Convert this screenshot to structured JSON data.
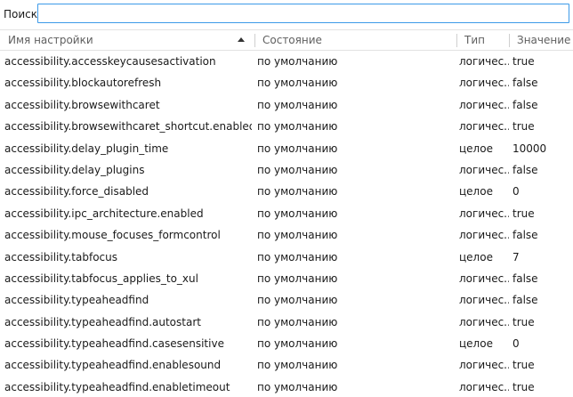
{
  "search": {
    "label": "Поиск:",
    "value": "",
    "placeholder": ""
  },
  "columns": {
    "name": "Имя настройки",
    "state": "Состояние",
    "type": "Тип",
    "value": "Значение"
  },
  "sort": {
    "column": "name",
    "direction": "ascending"
  },
  "rows": [
    {
      "name": "accessibility.accesskeycausesactivation",
      "state": "по умолчанию",
      "type": "логичес...",
      "value": "true"
    },
    {
      "name": "accessibility.blockautorefresh",
      "state": "по умолчанию",
      "type": "логичес...",
      "value": "false"
    },
    {
      "name": "accessibility.browsewithcaret",
      "state": "по умолчанию",
      "type": "логичес...",
      "value": "false"
    },
    {
      "name": "accessibility.browsewithcaret_shortcut.enabled",
      "state": "по умолчанию",
      "type": "логичес...",
      "value": "true"
    },
    {
      "name": "accessibility.delay_plugin_time",
      "state": "по умолчанию",
      "type": "целое",
      "value": "10000"
    },
    {
      "name": "accessibility.delay_plugins",
      "state": "по умолчанию",
      "type": "логичес...",
      "value": "false"
    },
    {
      "name": "accessibility.force_disabled",
      "state": "по умолчанию",
      "type": "целое",
      "value": "0"
    },
    {
      "name": "accessibility.ipc_architecture.enabled",
      "state": "по умолчанию",
      "type": "логичес...",
      "value": "true"
    },
    {
      "name": "accessibility.mouse_focuses_formcontrol",
      "state": "по умолчанию",
      "type": "логичес...",
      "value": "false"
    },
    {
      "name": "accessibility.tabfocus",
      "state": "по умолчанию",
      "type": "целое",
      "value": "7"
    },
    {
      "name": "accessibility.tabfocus_applies_to_xul",
      "state": "по умолчанию",
      "type": "логичес...",
      "value": "false"
    },
    {
      "name": "accessibility.typeaheadfind",
      "state": "по умолчанию",
      "type": "логичес...",
      "value": "false"
    },
    {
      "name": "accessibility.typeaheadfind.autostart",
      "state": "по умолчанию",
      "type": "логичес...",
      "value": "true"
    },
    {
      "name": "accessibility.typeaheadfind.casesensitive",
      "state": "по умолчанию",
      "type": "целое",
      "value": "0"
    },
    {
      "name": "accessibility.typeaheadfind.enablesound",
      "state": "по умолчанию",
      "type": "логичес...",
      "value": "true"
    },
    {
      "name": "accessibility.typeaheadfind.enabletimeout",
      "state": "по умолчанию",
      "type": "логичес...",
      "value": "true"
    }
  ],
  "colors": {
    "search_border": "#3c9ae8",
    "header_text": "#606060",
    "row_text": "#1a1a1a"
  }
}
